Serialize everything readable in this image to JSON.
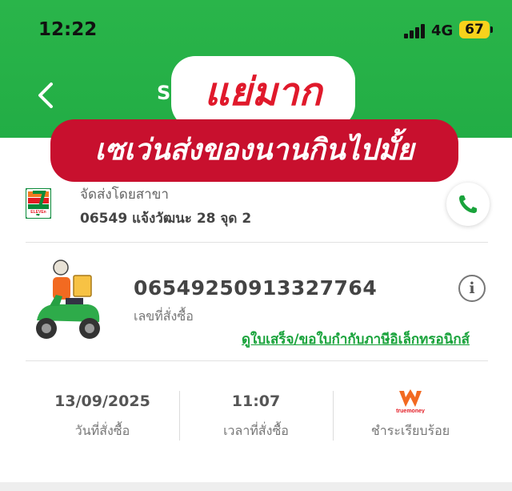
{
  "status_bar": {
    "time": "12:22",
    "network": "4G",
    "battery": "67"
  },
  "header": {
    "title_stub": "S"
  },
  "overlay": {
    "line1": "แย่มาก",
    "line2": "เซเว่นส่งของนานกินไปมั้ย"
  },
  "branch": {
    "label": "จัดส่งโดยสาขา",
    "name": "06549 แจ้งวัฒนะ 28 จุด 2",
    "logo_text": "ELEVEn"
  },
  "order": {
    "number": "06549250913327764",
    "number_label": "เลขที่สั่งซื้อ",
    "info_icon": "i",
    "receipt_link": "ดูใบเสร็จ/ขอใบกำกับภาษีอิเล็กทรอนิกส์"
  },
  "summary": {
    "date_value": "13/09/2025",
    "date_label": "วันที่สั่งซื้อ",
    "time_value": "11:07",
    "time_label": "เวลาที่สั่งซื้อ",
    "payment_logo_text": "truemoney",
    "payment_label": "ชำระเรียบร้อย"
  },
  "colors": {
    "header_green": "#22ad45",
    "link_green": "#19a33b",
    "stamp_red": "#c8102e",
    "battery_yellow": "#f7d21c"
  },
  "icons": {
    "back": "chevron-left-icon",
    "phone": "phone-icon",
    "info": "info-icon",
    "scooter": "delivery-scooter-icon"
  }
}
